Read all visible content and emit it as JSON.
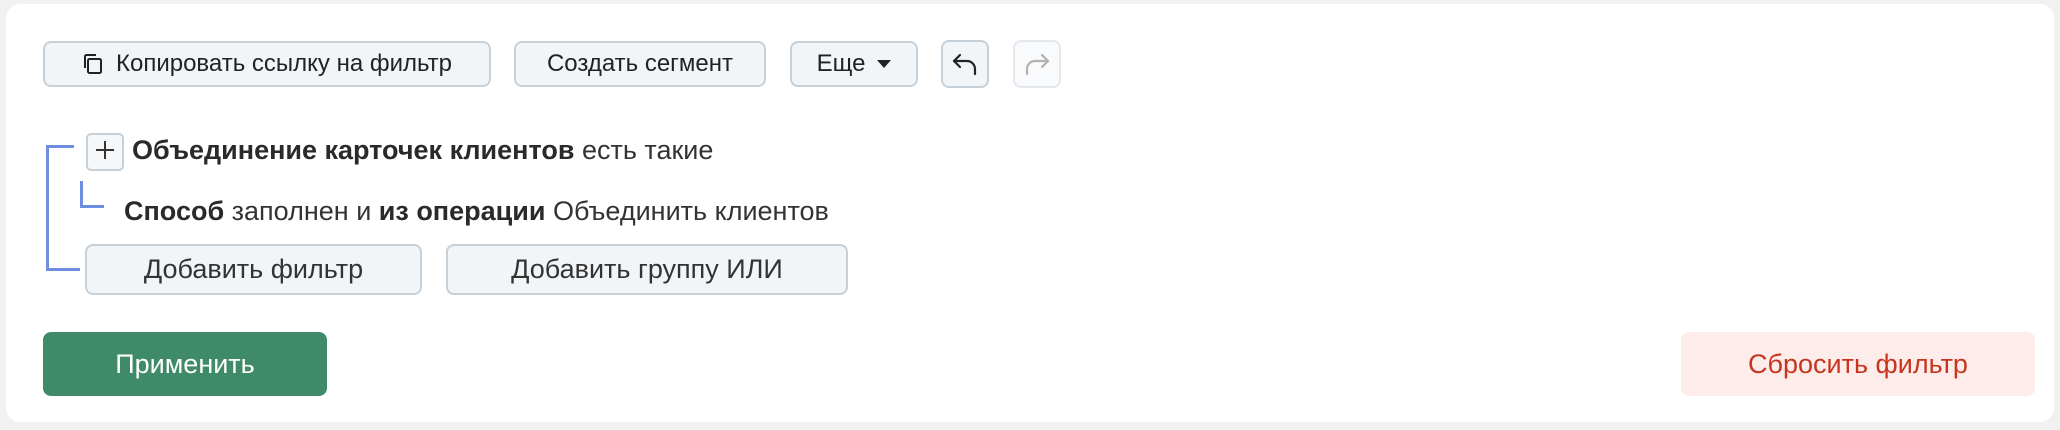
{
  "toolbar": {
    "copy_link_label": "Копировать ссылку на фильтр",
    "copy_icon": "copy-icon",
    "create_segment_label": "Создать сегмент",
    "more_label": "Еще",
    "more_icon": "caret-down-icon",
    "undo_icon": "undo-icon",
    "redo_icon": "redo-icon"
  },
  "filter": {
    "group_condition": {
      "field": "Объединение карточек клиентов",
      "operator": "есть такие"
    },
    "sub_condition": {
      "field": "Способ",
      "operator": "заполнен и",
      "field2": "из операции",
      "value": "Объединить клиентов"
    },
    "add_filter_label": "Добавить фильтр",
    "add_or_group_label": "Добавить группу ИЛИ",
    "bracket_color": "#6e8ee0"
  },
  "footer": {
    "apply_label": "Применить",
    "reset_label": "Сбросить фильтр",
    "apply_color": "#3f8b69",
    "reset_text_color": "#c8351f"
  }
}
